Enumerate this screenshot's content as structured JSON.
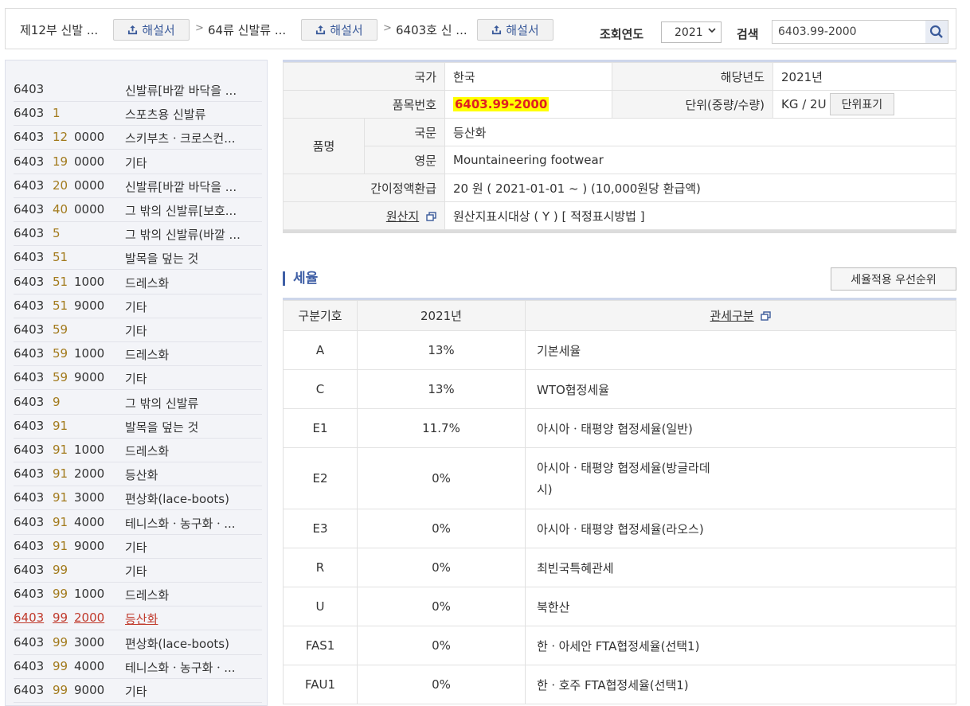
{
  "breadcrumb": {
    "part": "제12부 신발 ...",
    "chapter": "64류 신발류 ...",
    "heading": "6403호 신 ...",
    "explain_label": "해설서",
    "separator": ">"
  },
  "filters": {
    "year_label": "조회연도",
    "year_value": "2021",
    "search_label": "검색",
    "search_value": "6403.99-2000"
  },
  "tree": [
    {
      "a": "6403",
      "b": "",
      "c": "",
      "name": "신발류[바깥 바닥을 ..."
    },
    {
      "a": "6403",
      "b": "1",
      "c": "",
      "name": "스포츠용 신발류"
    },
    {
      "a": "6403",
      "b": "12",
      "c": "0000",
      "name": "스키부츠ㆍ크로스컨..."
    },
    {
      "a": "6403",
      "b": "19",
      "c": "0000",
      "name": "기타"
    },
    {
      "a": "6403",
      "b": "20",
      "c": "0000",
      "name": "신발류[바깥 바닥을 ..."
    },
    {
      "a": "6403",
      "b": "40",
      "c": "0000",
      "name": "그 밖의 신발류[보호..."
    },
    {
      "a": "6403",
      "b": "5",
      "c": "",
      "name": "그 밖의 신발류(바깥 ..."
    },
    {
      "a": "6403",
      "b": "51",
      "c": "",
      "name": "발목을 덮는 것"
    },
    {
      "a": "6403",
      "b": "51",
      "c": "1000",
      "name": "드레스화"
    },
    {
      "a": "6403",
      "b": "51",
      "c": "9000",
      "name": "기타"
    },
    {
      "a": "6403",
      "b": "59",
      "c": "",
      "name": "기타"
    },
    {
      "a": "6403",
      "b": "59",
      "c": "1000",
      "name": "드레스화"
    },
    {
      "a": "6403",
      "b": "59",
      "c": "9000",
      "name": "기타"
    },
    {
      "a": "6403",
      "b": "9",
      "c": "",
      "name": "그 밖의 신발류"
    },
    {
      "a": "6403",
      "b": "91",
      "c": "",
      "name": "발목을 덮는 것"
    },
    {
      "a": "6403",
      "b": "91",
      "c": "1000",
      "name": "드레스화"
    },
    {
      "a": "6403",
      "b": "91",
      "c": "2000",
      "name": "등산화"
    },
    {
      "a": "6403",
      "b": "91",
      "c": "3000",
      "name": "편상화(lace-boots)"
    },
    {
      "a": "6403",
      "b": "91",
      "c": "4000",
      "name": "테니스화ㆍ농구화ㆍ..."
    },
    {
      "a": "6403",
      "b": "91",
      "c": "9000",
      "name": "기타"
    },
    {
      "a": "6403",
      "b": "99",
      "c": "",
      "name": "기타"
    },
    {
      "a": "6403",
      "b": "99",
      "c": "1000",
      "name": "드레스화"
    },
    {
      "a": "6403",
      "b": "99",
      "c": "2000",
      "name": "등산화"
    },
    {
      "a": "6403",
      "b": "99",
      "c": "3000",
      "name": "편상화(lace-boots)"
    },
    {
      "a": "6403",
      "b": "99",
      "c": "4000",
      "name": "테니스화ㆍ농구화ㆍ..."
    },
    {
      "a": "6403",
      "b": "99",
      "c": "9000",
      "name": "기타"
    }
  ],
  "info": {
    "country_label": "국가",
    "country_value": "한국",
    "year_label": "해당년도",
    "year_value": "2021년",
    "code_label": "품목번호",
    "code_value": "6403.99-2000",
    "unit_label": "단위(중량/수량)",
    "unit_value": "KG / 2U",
    "unit_button": "단위표기",
    "name_label": "품명",
    "kor_label": "국문",
    "kor_value": "등산화",
    "eng_label": "영문",
    "eng_value": "Mountaineering footwear",
    "refund_label": "간이정액환급",
    "refund_value": "20 원 ( 2021-01-01 ~ ) (10,000원당 환급액)",
    "origin_label": "원산지",
    "origin_value": "원산지표시대상 ( Y ) [ 적정표시방법 ]"
  },
  "tariff": {
    "title": "세율",
    "priority_button": "세율적용 우선순위",
    "headers": [
      "구분기호",
      "2021년",
      "관세구분"
    ],
    "rows": [
      {
        "code": "A",
        "rate": "13%",
        "desc": "기본세율"
      },
      {
        "code": "C",
        "rate": "13%",
        "desc": "WTO협정세율"
      },
      {
        "code": "E1",
        "rate": "11.7%",
        "desc": "아시아ㆍ태평양 협정세율(일반)"
      },
      {
        "code": "E2",
        "rate": "0%",
        "desc": "아시아ㆍ태평양 협정세율(방글라데",
        "desc2": "시)"
      },
      {
        "code": "E3",
        "rate": "0%",
        "desc": "아시아ㆍ태평양 협정세율(라오스)"
      },
      {
        "code": "R",
        "rate": "0%",
        "desc": "최빈국특혜관세"
      },
      {
        "code": "U",
        "rate": "0%",
        "desc": "북한산"
      },
      {
        "code": "FAS1",
        "rate": "0%",
        "desc": "한ㆍ아세안 FTA협정세율(선택1)"
      },
      {
        "code": "FAU1",
        "rate": "0%",
        "desc": "한ㆍ호주 FTA협정세율(선택1)"
      }
    ]
  },
  "colors": {
    "accent": "#3f5fa6",
    "highlight": "#ffff00",
    "code_red": "#e02020"
  }
}
